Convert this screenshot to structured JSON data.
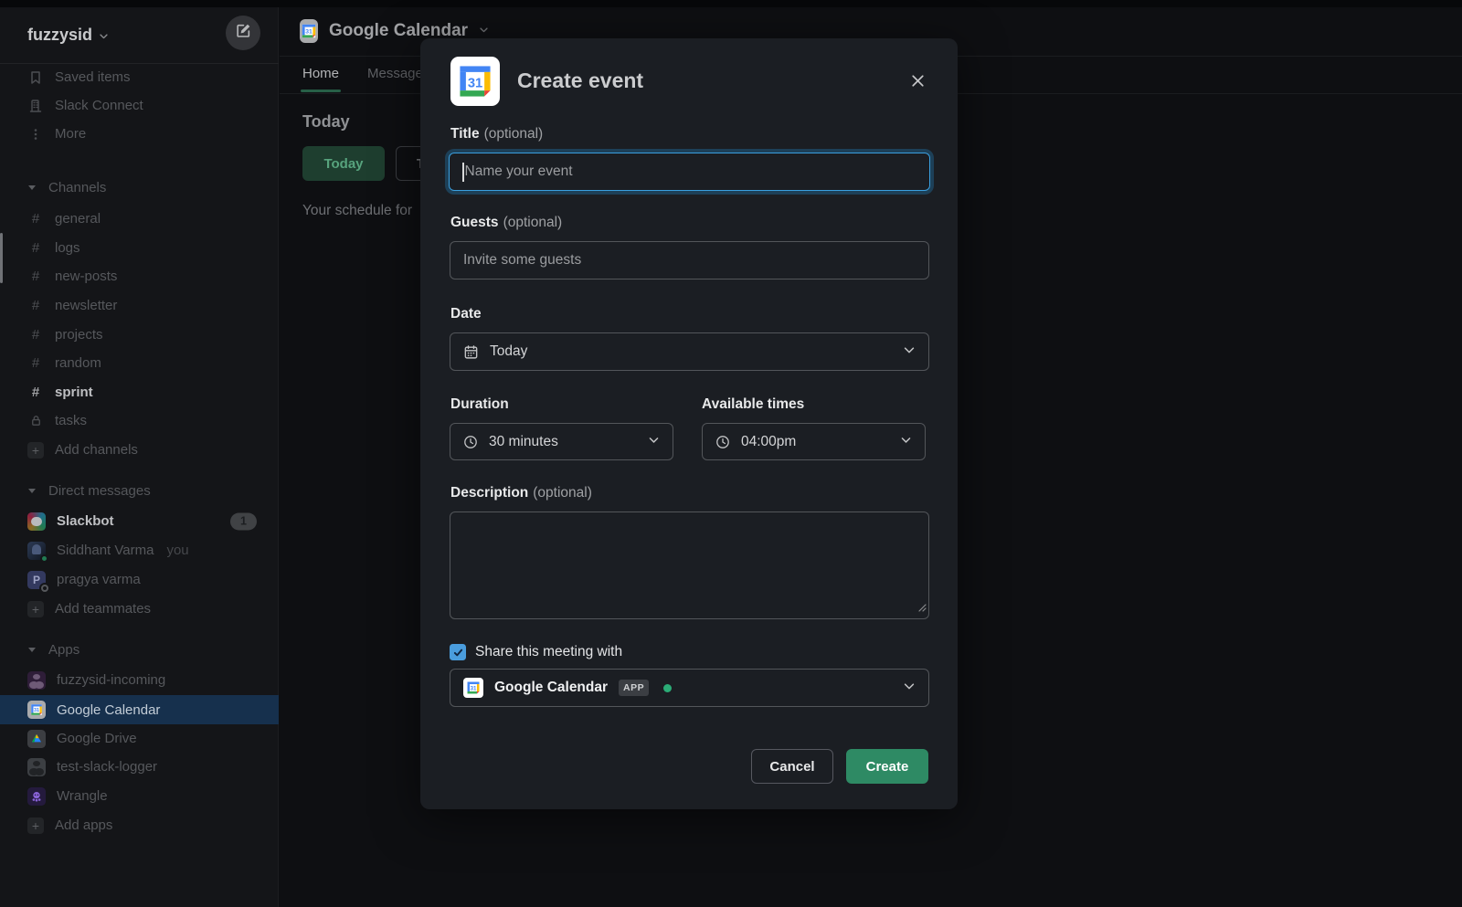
{
  "workspace": {
    "name": "fuzzysid"
  },
  "sidebar": {
    "nav": [
      {
        "label": "Saved items"
      },
      {
        "label": "Slack Connect"
      },
      {
        "label": "More"
      }
    ],
    "sections": {
      "channels": "Channels",
      "dms": "Direct messages",
      "apps": "Apps"
    },
    "channels": [
      {
        "label": "general"
      },
      {
        "label": "logs"
      },
      {
        "label": "new-posts"
      },
      {
        "label": "newsletter"
      },
      {
        "label": "projects"
      },
      {
        "label": "random"
      },
      {
        "label": "sprint"
      },
      {
        "label": "tasks"
      }
    ],
    "add_channels": "Add channels",
    "dms": [
      {
        "name": "Slackbot",
        "badge": "1"
      },
      {
        "name": "Siddhant Varma",
        "suffix": "you"
      },
      {
        "name": "pragya varma",
        "initial": "P"
      }
    ],
    "add_teammates": "Add teammates",
    "apps": [
      {
        "label": "fuzzysid-incoming"
      },
      {
        "label": "Google Calendar"
      },
      {
        "label": "Google Drive"
      },
      {
        "label": "test-slack-logger"
      },
      {
        "label": "Wrangle"
      }
    ],
    "add_apps": "Add apps"
  },
  "main": {
    "app_title": "Google Calendar",
    "tabs": [
      {
        "label": "Home"
      },
      {
        "label": "Messages"
      }
    ],
    "today_heading": "Today",
    "today_button": "Today",
    "tomorrow_button": "Tomorrow",
    "schedule_text": "Your schedule for"
  },
  "modal": {
    "title": "Create event",
    "title_field": {
      "label": "Title",
      "optional": "(optional)",
      "placeholder": "Name your event"
    },
    "guests_field": {
      "label": "Guests",
      "optional": "(optional)",
      "placeholder": "Invite some guests"
    },
    "date_field": {
      "label": "Date",
      "value": "Today"
    },
    "duration_field": {
      "label": "Duration",
      "value": "30 minutes"
    },
    "times_field": {
      "label": "Available times",
      "value": "04:00pm"
    },
    "description_field": {
      "label": "Description",
      "optional": "(optional)"
    },
    "share": {
      "label": "Share this meeting with",
      "app_name": "Google Calendar",
      "badge": "APP"
    },
    "cancel_label": "Cancel",
    "create_label": "Create"
  },
  "colors": {
    "accent_green": "#2e8a64",
    "focus_blue": "#3aa0e0",
    "checkbox_blue": "#4a9ddd",
    "selected_row_blue": "#16304d",
    "presence_green": "#2bac76",
    "modal_bg": "#1b1e23",
    "sidebar_bg": "#141518"
  }
}
